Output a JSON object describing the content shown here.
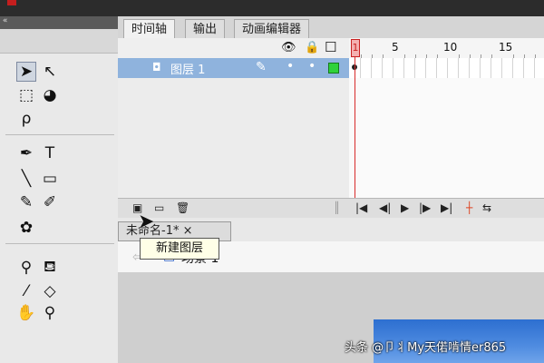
{
  "timeline": {
    "tabs": [
      {
        "label": "时间轴"
      },
      {
        "label": "输出"
      },
      {
        "label": "动画编辑器"
      }
    ],
    "ruler_labels": [
      "1",
      "5",
      "10",
      "15"
    ],
    "layer": {
      "name": "图层 1"
    },
    "icons": {
      "visibility": "eye-icon",
      "lock": "lock-icon",
      "outline": "outline-square-icon"
    }
  },
  "document": {
    "tab_label": "未命名-1* ×",
    "scene_label": "场景 1"
  },
  "tooltip": {
    "text": "新建图层"
  },
  "watermark": {
    "text": "头条 @卩丬My天偌啃情er865"
  }
}
